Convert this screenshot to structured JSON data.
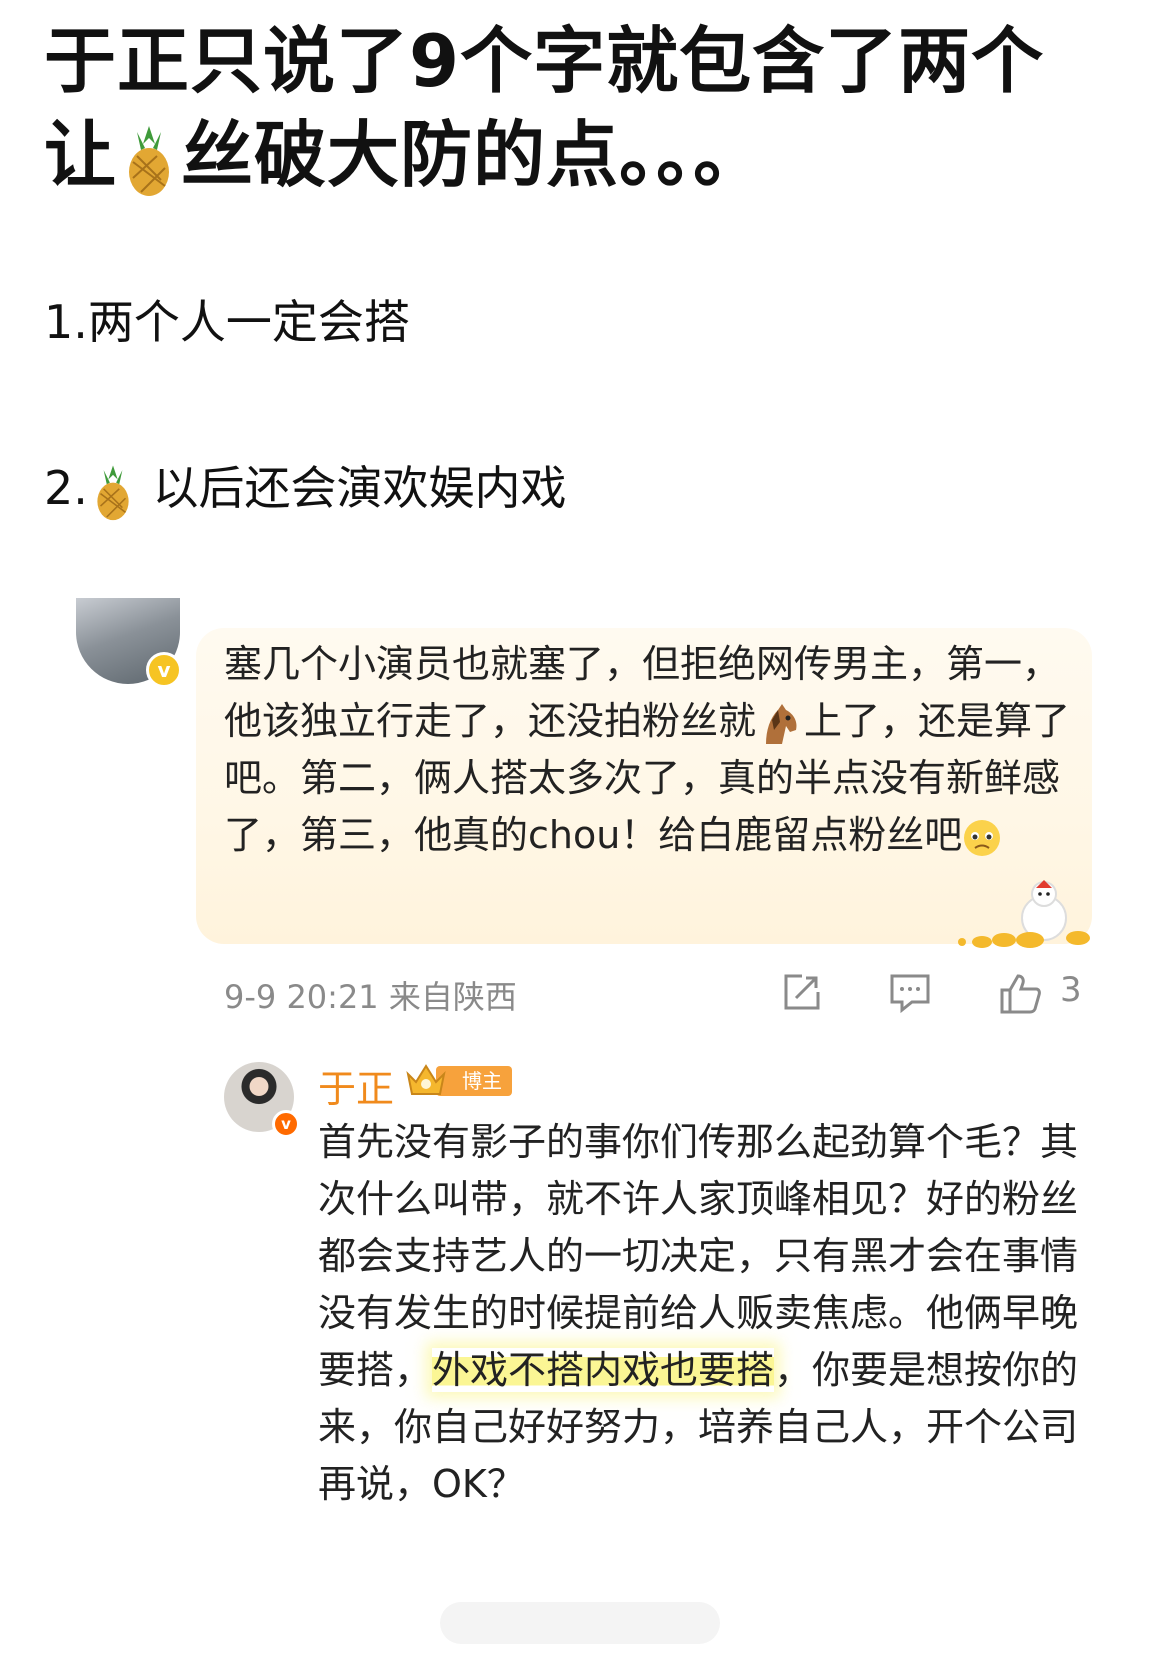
{
  "post": {
    "title_line1": "于正只说了9个字就包含了两个",
    "title_line2_pre": "让",
    "title_line2_post": "丝破大防的点。。。",
    "point1": "1.两个人一定会搭",
    "point2_pre": "2.",
    "point2_post": "以后还会演欢娱内戏"
  },
  "comment": {
    "text_part1": "塞几个小演员也就塞了，但拒绝网传男主，第一，他该独立行走了，还没拍粉丝就",
    "text_part2": "上了，还是算了吧。第二，俩人搭太多次了，真的半点没有新鲜感了，第三，他真的chou！给白鹿留点粉丝吧",
    "time": "9-9 20:21",
    "location": "来自陕西",
    "likes": "3",
    "icons": [
      "share-icon",
      "comment-icon",
      "like-icon"
    ]
  },
  "reply": {
    "name": "于正",
    "badge": "博主",
    "text_pre": "首先没有影子的事你们传那么起劲算个毛？其次什么叫带，就不许人家顶峰相见？好的粉丝都会支持艺人的一切决定，只有黑才会在事情没有发生的时候提前给人贩卖焦虑。他俩早晚要搭，",
    "text_highlight": "外戏不搭内戏也要搭",
    "text_post": "，你要是想按你的来，你自己好好努力，培养自己人，开个公司再说，OK？"
  },
  "colors": {
    "reply_name": "#f08a1c",
    "highlight": "#faf482",
    "meta_gray": "#8a8a8a",
    "verified_badge": "#f6c423"
  }
}
